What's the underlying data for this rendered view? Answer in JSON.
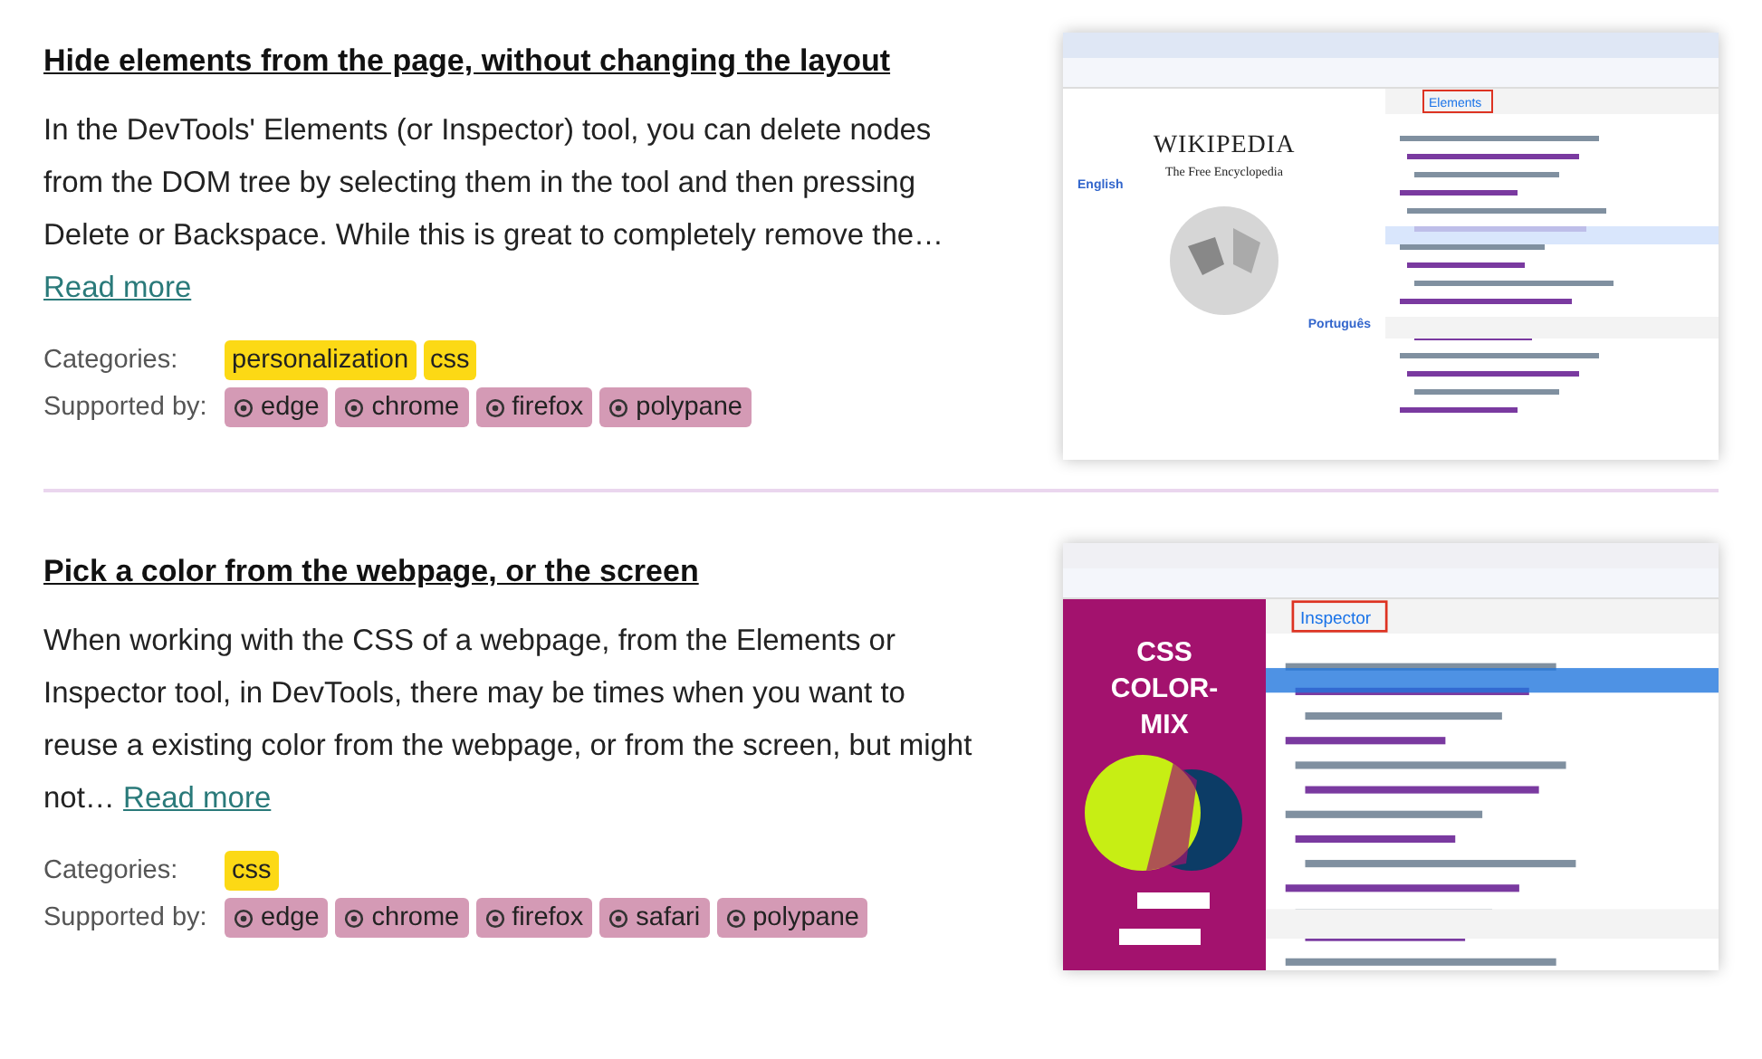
{
  "articles": [
    {
      "title": "Hide elements from the page, without changing the layout",
      "summary": "In the DevTools' Elements (or Inspector) tool, you can delete nodes from the DOM tree by selecting them in the tool and then pressing Delete or Backspace. While this is great to completely remove the…",
      "read_more": "Read more",
      "categories_label": "Categories:",
      "categories": [
        "personalization",
        "css"
      ],
      "supported_label": "Supported by:",
      "supported_by": [
        "edge",
        "chrome",
        "firefox",
        "polypane"
      ],
      "screenshot": {
        "kind": "chrome",
        "page_title": "WIKIPEDIA",
        "page_subtitle": "The Free Encyclopedia",
        "link_left": "English",
        "link_right": "Português",
        "active_tab": "Elements"
      }
    },
    {
      "title": "Pick a color from the webpage, or the screen",
      "summary": "When working with the CSS of a webpage, from the Elements or Inspector tool, in DevTools, there may be times when you want to reuse a existing color from the webpage, or from the screen, but might not…",
      "read_more": "Read more",
      "categories_label": "Categories:",
      "categories": [
        "css"
      ],
      "supported_label": "Supported by:",
      "supported_by": [
        "edge",
        "chrome",
        "firefox",
        "safari",
        "polypane"
      ],
      "screenshot": {
        "kind": "firefox",
        "page_title": "CSS COLOR-MIX",
        "active_tab": "Inspector"
      }
    }
  ]
}
